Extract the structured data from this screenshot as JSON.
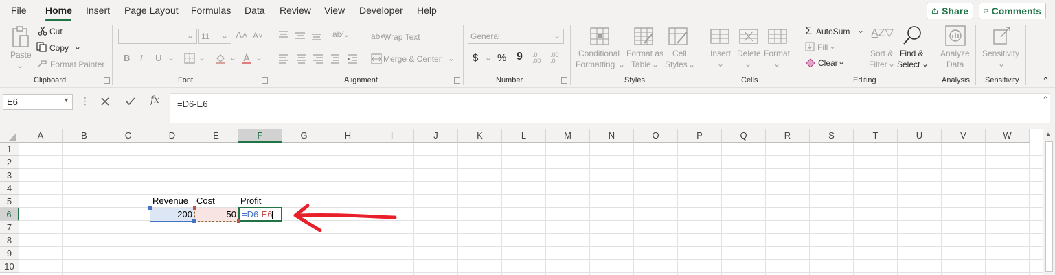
{
  "menu": {
    "tabs": [
      "File",
      "Home",
      "Insert",
      "Page Layout",
      "Formulas",
      "Data",
      "Review",
      "View",
      "Developer",
      "Help"
    ],
    "share_label": "Share",
    "comments_label": "Comments"
  },
  "ribbon": {
    "clipboard": {
      "paste": "Paste",
      "cut": "Cut",
      "copy": "Copy",
      "format_painter": "Format Painter",
      "group": "Clipboard"
    },
    "font": {
      "font_size": "11",
      "bold": "B",
      "italic": "I",
      "underline": "U",
      "group": "Font"
    },
    "alignment": {
      "wrap_text": "Wrap Text",
      "merge_center": "Merge & Center",
      "group": "Alignment"
    },
    "number": {
      "format": "General",
      "currency": "$",
      "percent": "%",
      "comma": "9",
      "inc_decimal": ".0 .00",
      "dec_decimal": ".00 .0",
      "group": "Number"
    },
    "styles": {
      "conditional_1": "Conditional",
      "conditional_2": "Formatting",
      "format_table_1": "Format as",
      "format_table_2": "Table",
      "cell_styles_1": "Cell",
      "cell_styles_2": "Styles",
      "group": "Styles"
    },
    "cells": {
      "insert": "Insert",
      "delete": "Delete",
      "format": "Format",
      "group": "Cells"
    },
    "editing": {
      "autosum": "AutoSum",
      "fill": "Fill",
      "clear": "Clear",
      "sort_1": "Sort &",
      "sort_2": "Filter",
      "find_1": "Find &",
      "find_2": "Select",
      "group": "Editing"
    },
    "analysis": {
      "analyze_1": "Analyze",
      "analyze_2": "Data",
      "group": "Analysis"
    },
    "sensitivity": {
      "label": "Sensitivity",
      "group": "Sensitivity"
    }
  },
  "formula_bar": {
    "name_box": "E6",
    "fx_symbol": "fx",
    "formula": "=D6-E6"
  },
  "grid": {
    "columns": [
      "A",
      "B",
      "C",
      "D",
      "E",
      "F",
      "G",
      "H",
      "I",
      "J",
      "K",
      "L",
      "M",
      "N",
      "O",
      "P",
      "Q",
      "R",
      "S",
      "T",
      "U",
      "V",
      "W"
    ],
    "rows": [
      "1",
      "2",
      "3",
      "4",
      "5",
      "6",
      "7",
      "8",
      "9",
      "10"
    ],
    "cells": {
      "D5": "Revenue",
      "E5": "Cost",
      "F5": "Profit",
      "D6": "200",
      "E6": "50",
      "F6_ref1": "=D6",
      "F6_minus": "-",
      "F6_ref2": "E6"
    }
  },
  "colors": {
    "accent": "#217346",
    "ref1": "#4472c4",
    "ref2": "#c0504d",
    "annotation": "#e8202a"
  }
}
